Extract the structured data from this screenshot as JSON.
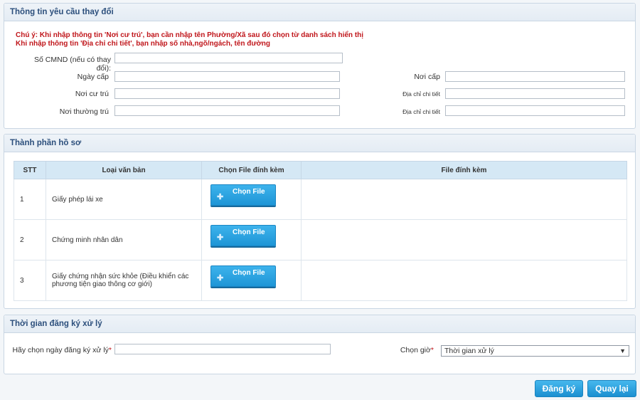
{
  "section_change": {
    "title": "Thông tin yêu cầu thay đổi",
    "note_line1": "Chú ý: Khi nhập thông tin 'Nơi cư trú', bạn cần nhập tên Phường/Xã sau đó chọn từ danh sách hiển thị",
    "note_line2": "Khi nhập thông tin 'Địa chỉ chi tiết', bạn nhập số nhà,ngõ/ngách, tên đường",
    "cmnd_label": "Số CMND (nếu có thay đổi):",
    "issue_date_label": "Ngày cấp",
    "issue_place_label": "Nơi cấp",
    "residence_label": "Nơi cư trú",
    "residence_detail_label": "Địa chỉ chi tiết",
    "permanent_label": "Nơi thường trú",
    "permanent_detail_label": "Địa chỉ chi tiết"
  },
  "section_docs": {
    "title": "Thành phần hồ sơ",
    "columns": [
      "STT",
      "Loại văn bản",
      "Chọn File đính kèm",
      "File đính kèm"
    ],
    "rows": [
      {
        "stt": "1",
        "name": "Giấy phép lái xe",
        "button": "Chọn File"
      },
      {
        "stt": "2",
        "name": "Chứng minh nhân dân",
        "button": "Chọn File"
      },
      {
        "stt": "3",
        "name": "Giấy chứng nhận sức khỏe (Điều khiển các phương tiện giao thông cơ giới)",
        "button": "Chọn File"
      }
    ]
  },
  "section_time": {
    "title": "Thời gian đăng ký xử lý",
    "date_label": "Hãy chọn ngày đăng ký xử lý",
    "hour_label": "Chọn giờ",
    "required_mark": "*",
    "hour_selected": "Thời gian xử lý"
  },
  "actions": {
    "register": "Đăng ký",
    "back": "Quay lại"
  },
  "colors": {
    "accent": "#1e95d6",
    "header_text": "#2c4f7c",
    "note_text": "#c0161b"
  }
}
